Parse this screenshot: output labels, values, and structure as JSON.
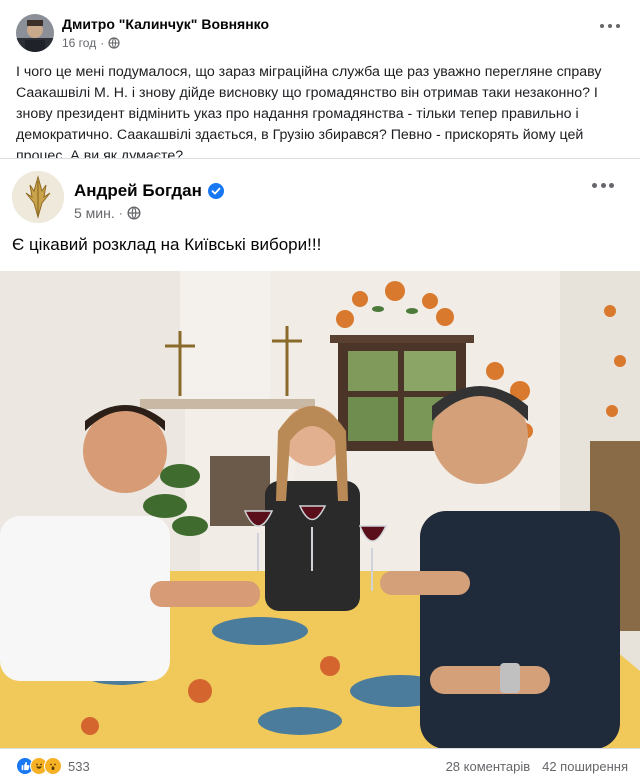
{
  "outer_post": {
    "author": "Дмитро \"Калинчук\" Вовнянко",
    "time": "16 год",
    "separator": "·",
    "privacy_icon": "globe-icon",
    "text": "І чого це мені подумалося, що зараз міграційна служба ще раз уважно перегляне справу Саакашвілі М. Н. і знову дійде висновку що громадянство він отримав таки незаконно? І знову президент відмінить указ про надання громадянства - тільки тепер правильно і демократично. Саакашвілі здається, в Грузію збирався? Певно - прискорять йому цей процес. А ви як думаєте?"
  },
  "shared_post": {
    "author": "Андрей Богдан",
    "verified_icon": "verified-badge-icon",
    "time": "5 мин.",
    "separator": "·",
    "privacy_icon": "globe-icon",
    "text": "Є цікавий розклад на Київські вибори!!!"
  },
  "footer": {
    "reactions": [
      "like-icon",
      "haha-icon",
      "wow-icon"
    ],
    "reaction_count": "533",
    "comments": "28 коментарів",
    "shares": "42 поширення"
  },
  "colors": {
    "link_blue": "#1877f2",
    "secondary_text": "#65676b"
  }
}
